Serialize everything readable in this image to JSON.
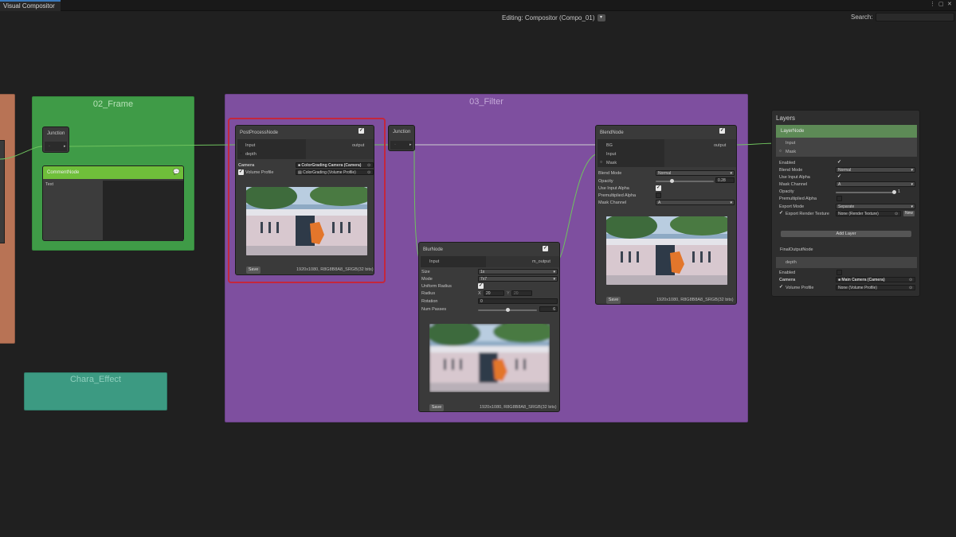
{
  "window": {
    "tab_label": "Visual Compositor",
    "editing_label": "Editing: Compositor (Compo_01)",
    "search_label": "Search:",
    "search_value": ""
  },
  "groups": {
    "frame": {
      "title": "02_Frame"
    },
    "filter": {
      "title": "03_Filter"
    },
    "chara": {
      "title": "Chara_Effect"
    }
  },
  "colors": {
    "frame_green": "#3f9b47",
    "filter_purple": "#7e4f9f",
    "chara_teal": "#3c9a82",
    "selection_red": "#c4273c",
    "wire_green": "#6fc35e"
  },
  "junction_left": {
    "title": "Junction"
  },
  "comment_node": {
    "title": "CommentNode",
    "text_label": "Text"
  },
  "postprocess": {
    "title": "PostProcessNode",
    "inputs": [
      "Input",
      "depth"
    ],
    "output": "output",
    "camera_label": "Camera",
    "camera_value": "ColorGrading Camera (Camera)",
    "volume_label": "Volume Profile",
    "volume_value": "ColorGrading (Volume Profile)",
    "save": "Save",
    "resolution": "1920x1080, R8G8B8A8_SRGB(32 bits)"
  },
  "junction_mid": {
    "title": "Junction"
  },
  "blur": {
    "title": "BlurNode",
    "input": "Input",
    "output": "m_output",
    "props": {
      "size_label": "Size",
      "size_value": "1x",
      "mode_label": "Mode",
      "mode_value": "7x7",
      "uniform_label": "Uniform Radius",
      "radius_label": "Radius",
      "radius_x_label": "X",
      "radius_x": "20",
      "radius_y_label": "Y",
      "radius_y": "20",
      "rotation_label": "Rotation",
      "rotation_value": "0",
      "passes_label": "Num Passes",
      "passes_value": "6",
      "passes_fraction": 0.5
    },
    "save": "Save",
    "resolution": "1920x1080, R8G8B8A8_SRGB(32 bits)"
  },
  "blend": {
    "title": "BlendNode",
    "inputs": [
      "BG",
      "Input",
      "Mask"
    ],
    "output": "output",
    "props": {
      "blend_mode_label": "Blend Mode",
      "blend_mode_value": "Normal",
      "opacity_label": "Opacity",
      "opacity_value": "0.28",
      "opacity_fraction": 0.28,
      "use_input_alpha_label": "Use Input Alpha",
      "premultiplied_label": "Premultiplied Alpha",
      "mask_channel_label": "Mask Channel",
      "mask_channel_value": "A"
    },
    "save": "Save",
    "resolution": "1920x1080, R8G8B8A8_SRGB(32 bits)"
  },
  "layers": {
    "title": "Layers",
    "layer_node": "LayerNode",
    "layer_inputs": [
      "Input",
      "Mask"
    ],
    "props": {
      "enabled_label": "Enabled",
      "blend_mode_label": "Blend Mode",
      "blend_mode_value": "Normal",
      "use_input_alpha_label": "Use Input Alpha",
      "mask_channel_label": "Mask Channel",
      "mask_channel_value": "A",
      "opacity_label": "Opacity",
      "opacity_value": "1",
      "opacity_fraction": 1,
      "premultiplied_label": "Premultiplied Alpha",
      "export_mode_label": "Export Mode",
      "export_mode_value": "Separate",
      "export_rt_label": "Export Render Texture",
      "export_rt_value": "None (Render Texture)",
      "new_label": "New"
    },
    "add_layer": "Add Layer",
    "final_node": "FinalOutputNode",
    "final_input": "depth",
    "final_props": {
      "enabled_label": "Enabled",
      "camera_label": "Camera",
      "camera_value": "Main Camera (Camera)",
      "volume_label": "Volume Profile",
      "volume_value": "None (Volume Profile)"
    }
  },
  "icons": {
    "kebab": "kebab-menu-icon",
    "maximize": "maximize-icon",
    "close": "close-icon",
    "comment": "comment-bubble-icon",
    "camera": "camera-icon",
    "volume": "volume-profile-icon"
  }
}
